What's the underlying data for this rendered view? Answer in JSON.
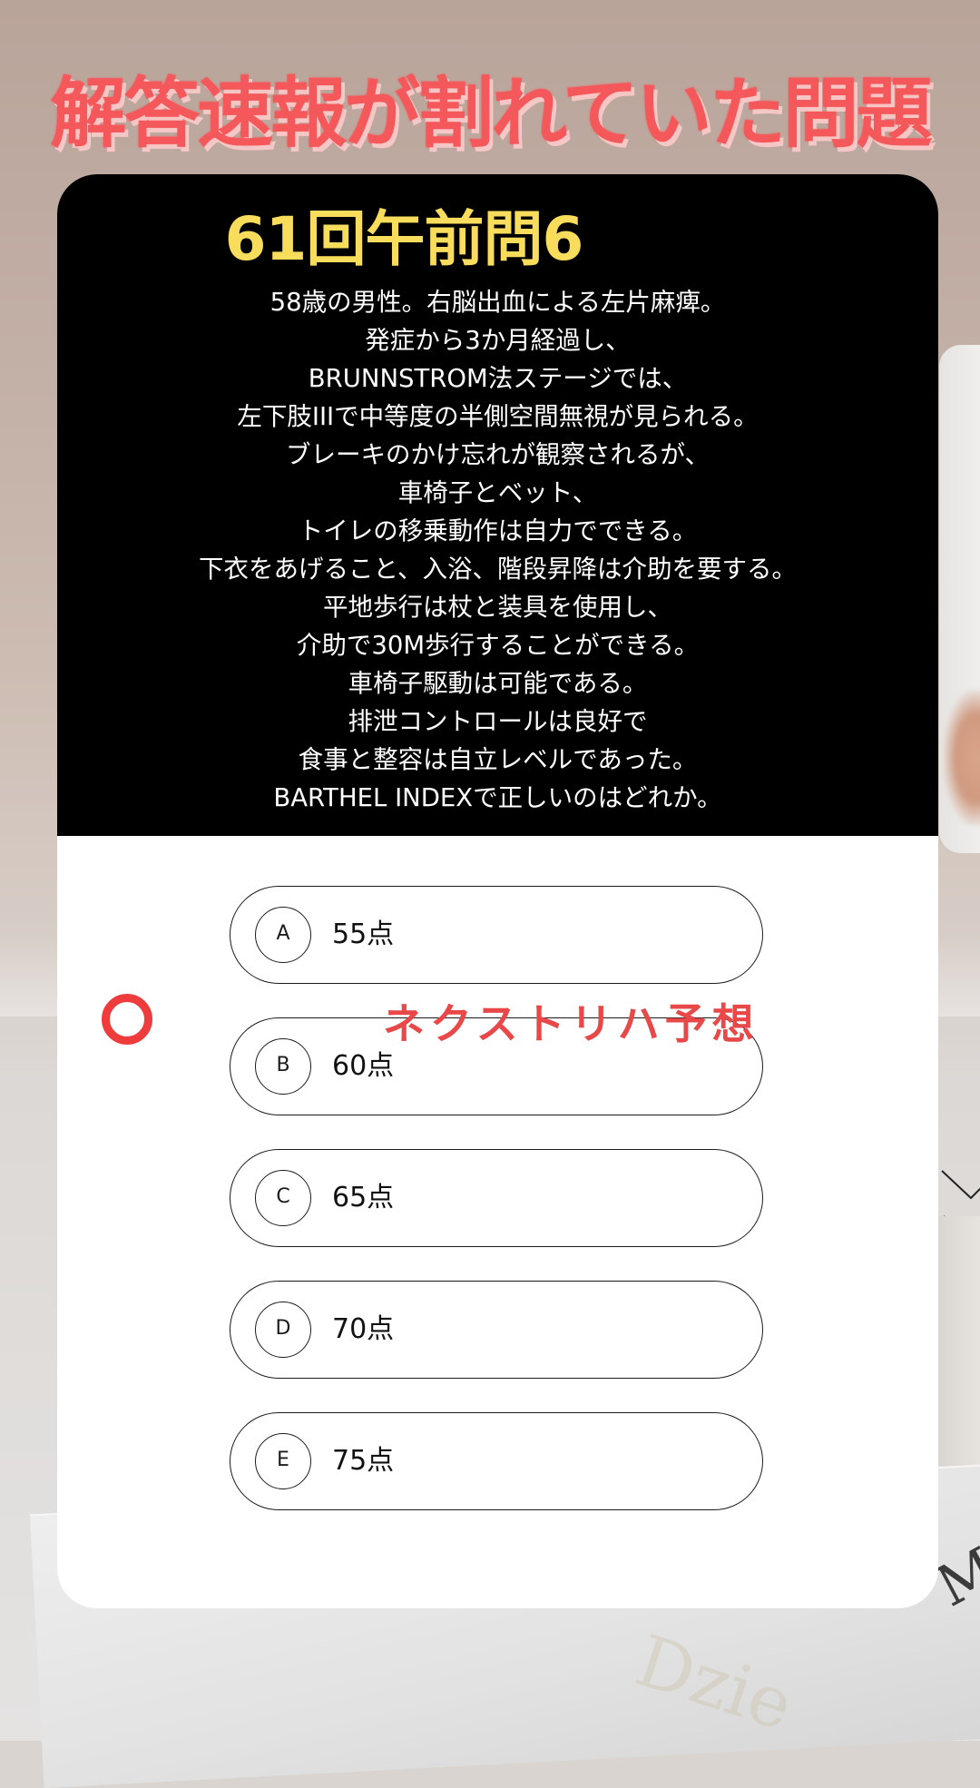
{
  "headline": "解答速報が割れていた問題",
  "question": {
    "number": "61回午前問6",
    "lines": [
      "58歳の男性。右脳出血による左片麻痺。",
      "発症から3か月経過し、",
      "BRUNNSTROM法ステージでは、",
      "左下肢IIIで中等度の半側空間無視が見られる。",
      "ブレーキのかけ忘れが観察されるが、",
      "車椅子とベット、",
      "トイレの移乗動作は自力でできる。",
      "下衣をあげること、入浴、階段昇降は介助を要する。",
      "平地歩行は杖と装具を使用し、",
      "介助で30M歩行することができる。",
      "車椅子駆動は可能である。",
      "排泄コントロールは良好で",
      "食事と整容は自立レベルであった。",
      "BARTHEL INDEXで正しいのはどれか。"
    ]
  },
  "options": [
    {
      "letter": "A",
      "value": "55点"
    },
    {
      "letter": "B",
      "value": "60点"
    },
    {
      "letter": "C",
      "value": "65点"
    },
    {
      "letter": "D",
      "value": "70点"
    },
    {
      "letter": "E",
      "value": "75点"
    }
  ],
  "prediction": {
    "selected_letter": "C",
    "label": "ネクストリハ予想"
  },
  "background": {
    "book_text": "MA",
    "watermark": "Dzie"
  },
  "colors": {
    "headline": "#f4585a",
    "question_number": "#f8dc5c",
    "card_top": "#000000",
    "card_bottom": "#ffffff",
    "correct_mark": "#ee3b3b",
    "prediction_label": "#e84848"
  }
}
